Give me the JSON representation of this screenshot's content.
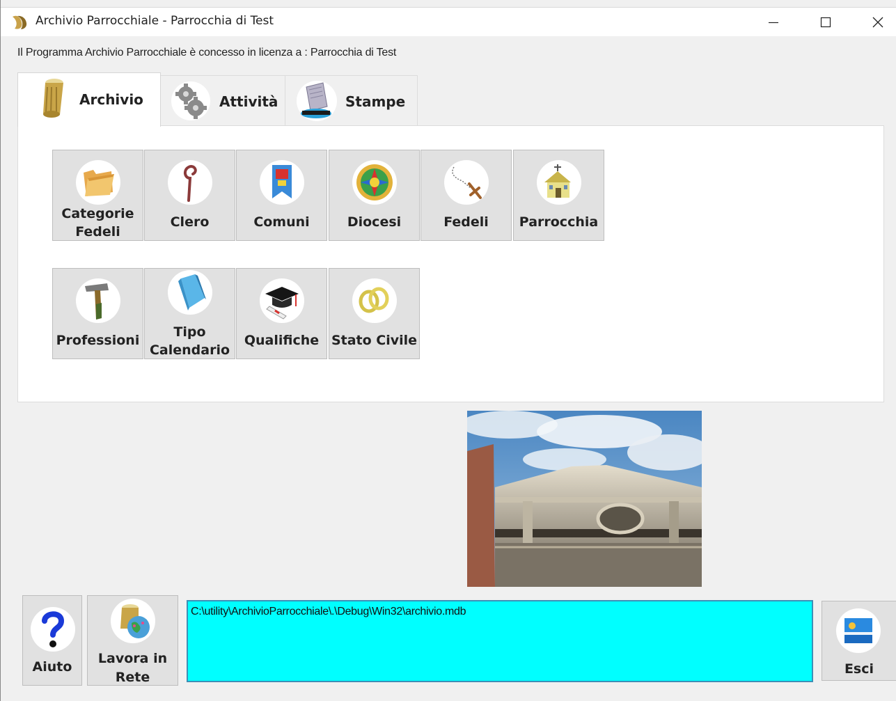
{
  "window": {
    "title": "Archivio Parrocchiale - Parrocchia di Test",
    "minimize_glyph": "—",
    "maximize_glyph": "☐",
    "close_glyph": "✕"
  },
  "license_text": "Il Programma Archivio Parrocchiale è concesso in licenza a : Parrocchia di Test",
  "tabs": [
    {
      "label": "Archivio",
      "icon": "scroll-icon",
      "active": true
    },
    {
      "label": "Attività",
      "icon": "gears-icon",
      "active": false
    },
    {
      "label": "Stampe",
      "icon": "printer-icon",
      "active": false
    }
  ],
  "archivio_tiles": {
    "row1": [
      {
        "label_line1": "Categorie",
        "label_line2": "Fedeli",
        "icon": "folder-icon"
      },
      {
        "label_line1": "Clero",
        "label_line2": "",
        "icon": "crozier-icon"
      },
      {
        "label_line1": "Comuni",
        "label_line2": "",
        "icon": "banner-icon"
      },
      {
        "label_line1": "Diocesi",
        "label_line2": "",
        "icon": "rose-window-icon"
      },
      {
        "label_line1": "Fedeli",
        "label_line2": "",
        "icon": "rosary-icon"
      },
      {
        "label_line1": "Parrocchia",
        "label_line2": "",
        "icon": "church-icon"
      }
    ],
    "row2": [
      {
        "label_line1": "Professioni",
        "label_line2": "",
        "icon": "hammer-icon"
      },
      {
        "label_line1": "Tipo",
        "label_line2": "Calendario",
        "icon": "calendar-book-icon"
      },
      {
        "label_line1": "Qualifiche",
        "label_line2": "",
        "icon": "graduation-cap-icon"
      },
      {
        "label_line1": "Stato Civile",
        "label_line2": "",
        "icon": "wedding-rings-icon"
      }
    ]
  },
  "bottom": {
    "help_label": "Aiuto",
    "network_label_line1": "Lavora in",
    "network_label_line2": "Rete",
    "db_path": "C:\\utility\\ArchivioParrocchiale\\.\\Debug\\Win32\\archivio.mdb",
    "exit_label": "Esci"
  },
  "colors": {
    "path_box_bg": "#00ffff",
    "tile_bg": "#e1e1e1",
    "window_bg": "#f0f0f0"
  }
}
